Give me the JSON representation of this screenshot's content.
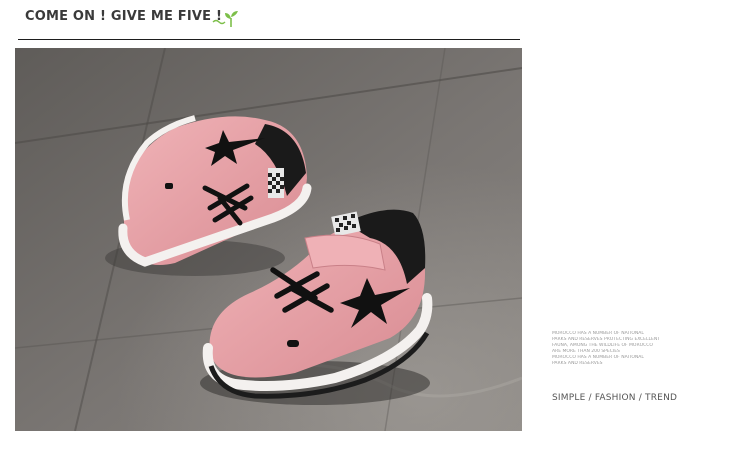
{
  "header": {
    "title": "COME ON ! GIVE ME FIVE !",
    "icon": "sprout-icon"
  },
  "photo": {
    "subject": "pink sneakers icon",
    "colors": {
      "shoe": "#e6a1a6",
      "floor": "#6d6a67",
      "accent": "#111111"
    }
  },
  "side_text": {
    "caption_lines": [
      "Morocco has a number of national",
      "parks and reserves protecting excellent",
      "fauna, among the wildlife of morocco",
      "are more than 200 species",
      "morocco has a number of national",
      "parks and reserves"
    ],
    "tagline": "SIMPLE / FASHION / TREND"
  }
}
